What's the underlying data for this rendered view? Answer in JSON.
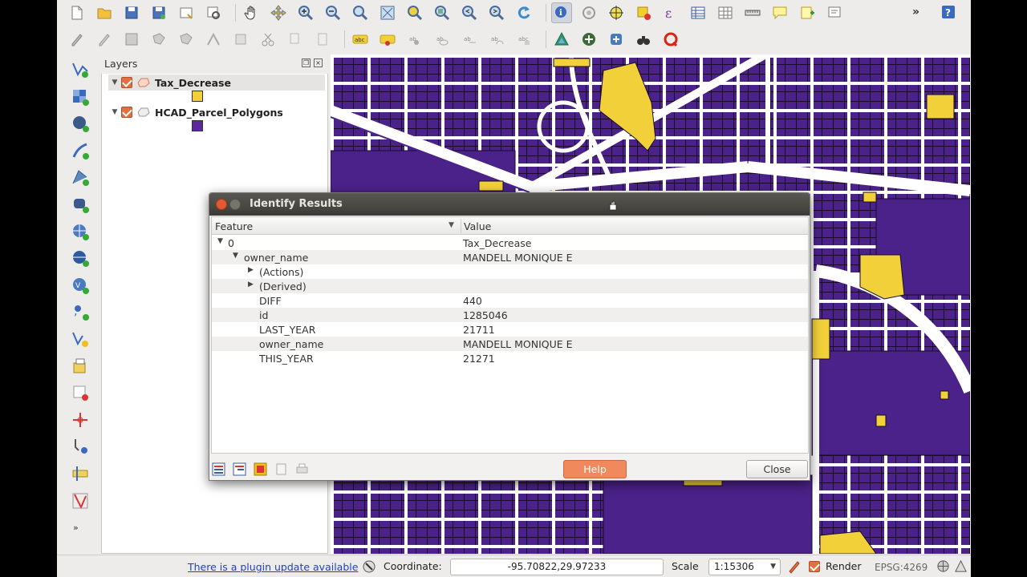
{
  "layers_panel": {
    "title": "Layers",
    "layers": [
      {
        "name": "Tax_Decrease",
        "swatch_color": "#f2d03a",
        "checked": true
      },
      {
        "name": "HCAD_Parcel_Polygons",
        "swatch_color": "#5b2a9a",
        "checked": true
      }
    ]
  },
  "dialog": {
    "title": "Identify Results",
    "columns": {
      "feature": "Feature",
      "value": "Value"
    },
    "rows": [
      {
        "key": "0",
        "value": "Tax_Decrease"
      },
      {
        "key": "owner_name",
        "value": "MANDELL MONIQUE E"
      },
      {
        "key": "(Actions)",
        "value": ""
      },
      {
        "key": "(Derived)",
        "value": ""
      },
      {
        "key": "DIFF",
        "value": "440"
      },
      {
        "key": "id",
        "value": "1285046"
      },
      {
        "key": "LAST_YEAR",
        "value": "21711"
      },
      {
        "key": "owner_name",
        "value": "MANDELL MONIQUE E"
      },
      {
        "key": "THIS_YEAR",
        "value": "21271"
      }
    ],
    "help_label": "Help",
    "close_label": "Close"
  },
  "status_bar": {
    "plugin_link": "There is a plugin update available",
    "coordinate_label": "Coordinate:",
    "coordinate_value": "-95.70822,29.97233",
    "scale_label": "Scale",
    "scale_value": "1:15306",
    "render_label": "Render",
    "crs": "EPSG:4269"
  },
  "colors": {
    "parcel_fill": "#4a2289",
    "tax_decrease_fill": "#f2d03a",
    "road": "#ffffff",
    "help_button": "#f08a5d"
  }
}
